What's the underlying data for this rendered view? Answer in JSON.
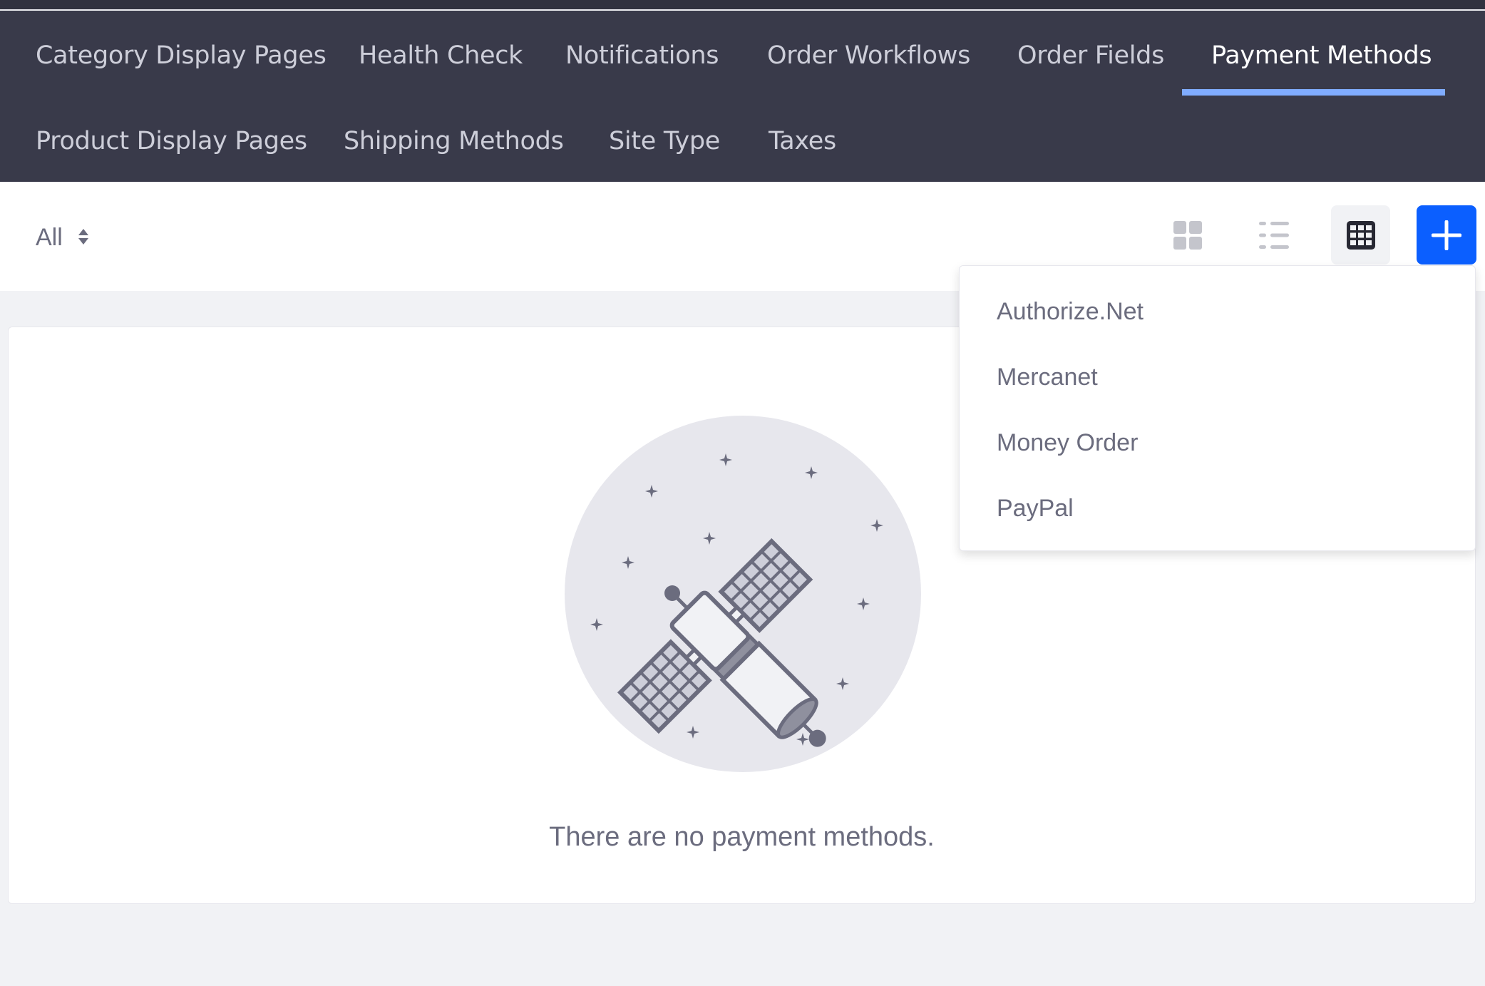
{
  "navbar": {
    "tabs": [
      {
        "label": "Category Display Pages",
        "active": false
      },
      {
        "label": "Health Check",
        "active": false
      },
      {
        "label": "Notifications",
        "active": false
      },
      {
        "label": "Order Workflows",
        "active": false
      },
      {
        "label": "Order Fields",
        "active": false
      },
      {
        "label": "Payment Methods",
        "active": true
      },
      {
        "label": "Product Display Pages",
        "active": false
      },
      {
        "label": "Shipping Methods",
        "active": false
      },
      {
        "label": "Site Type",
        "active": false
      },
      {
        "label": "Taxes",
        "active": false
      }
    ],
    "active_underline_color": "#80acff"
  },
  "toolbar": {
    "filter": {
      "label": "All",
      "icon": "sort-caret-icon"
    },
    "view_buttons": [
      {
        "name": "cards",
        "icon": "cards-view-icon",
        "active": false
      },
      {
        "name": "list",
        "icon": "list-view-icon",
        "active": false
      },
      {
        "name": "table",
        "icon": "table-view-icon",
        "active": true
      }
    ],
    "add_button": {
      "icon": "plus-icon",
      "color": "#0b5fff"
    }
  },
  "add_menu": {
    "items": [
      "Authorize.Net",
      "Mercanet",
      "Money Order",
      "PayPal"
    ]
  },
  "empty_state": {
    "illustration": "satellite-illustration",
    "message": "There are no payment methods."
  },
  "colors": {
    "navbar_bg": "#393a4a",
    "page_bg": "#f1f2f5",
    "text_secondary": "#6b6c7e",
    "primary": "#0b5fff"
  }
}
